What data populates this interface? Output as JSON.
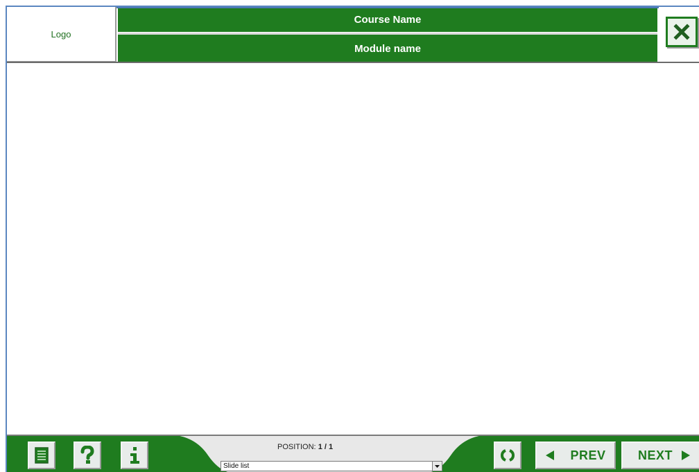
{
  "header": {
    "logo_text": "Logo",
    "course_name": "Course Name",
    "module_name": "Module name"
  },
  "footer": {
    "position_label": "POSITION:",
    "position_value": "1 / 1",
    "slide_list": {
      "selected": "Slide list"
    },
    "prev_label": "PREV",
    "next_label": "NEXT"
  },
  "icons": {
    "close": "close-icon",
    "table_of_contents": "list-icon",
    "help": "question-icon",
    "info": "info-icon",
    "replay": "replay-icon",
    "prev": "arrow-left-icon",
    "next": "arrow-right-icon"
  },
  "colors": {
    "accent": "#1f7c1f",
    "panel": "#e8e8e8",
    "frame": "#5a86c0"
  }
}
